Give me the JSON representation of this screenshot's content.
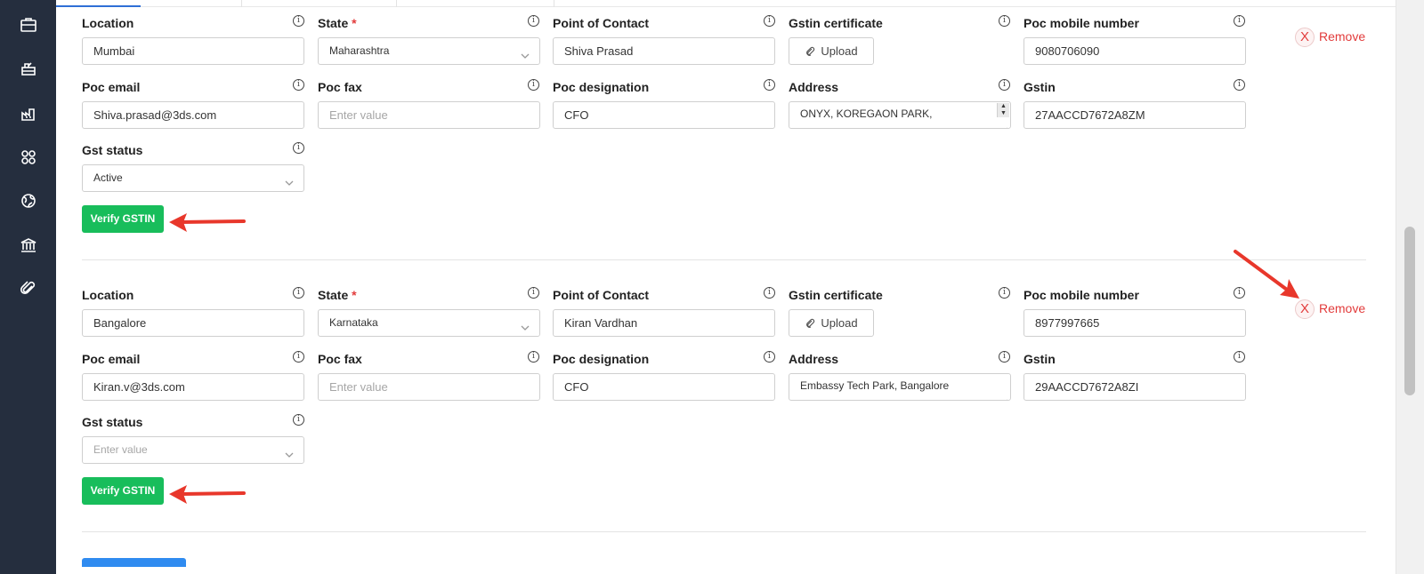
{
  "sidebar": {
    "icons": [
      "briefcase-icon",
      "truck-icon",
      "factory-icon",
      "grid-icon",
      "globe-icon",
      "bank-icon",
      "paperclip-icon"
    ]
  },
  "labels": {
    "location": "Location",
    "state": "State",
    "state_required": "*",
    "point_of_contact": "Point of Contact",
    "gstin_certificate": "Gstin certificate",
    "poc_mobile": "Poc mobile number",
    "poc_email": "Poc email",
    "poc_fax": "Poc fax",
    "poc_designation": "Poc designation",
    "address": "Address",
    "gstin": "Gstin",
    "gst_status": "Gst status",
    "info": "i",
    "upload": "Upload",
    "verify": "Verify GSTIN",
    "remove": "Remove",
    "remove_x": "X"
  },
  "entries": [
    {
      "location": "Mumbai",
      "state": "Maharashtra",
      "point_of_contact": "Shiva Prasad",
      "poc_mobile": "9080706090",
      "poc_email": "Shiva.prasad@3ds.com",
      "poc_fax_placeholder": "Enter value",
      "poc_designation": "CFO",
      "address": "ONYX, KOREGAON PARK,",
      "gstin": "27AACCD7672A8ZM",
      "gst_status": "Active"
    },
    {
      "location": "Bangalore",
      "state": "Karnataka",
      "point_of_contact": "Kiran Vardhan",
      "poc_mobile": "8977997665",
      "poc_email": "Kiran.v@3ds.com",
      "poc_fax_placeholder": "Enter value",
      "poc_designation": "CFO",
      "address": "Embassy Tech Park, Bangalore",
      "gstin": "29AACCD7672A8ZI",
      "gst_status_placeholder": "Enter value"
    }
  ],
  "colors": {
    "sidebar": "#252e3e",
    "verify_button": "#18bd5b",
    "remove": "#e23b3b",
    "annotation_arrow": "#e8372b"
  }
}
